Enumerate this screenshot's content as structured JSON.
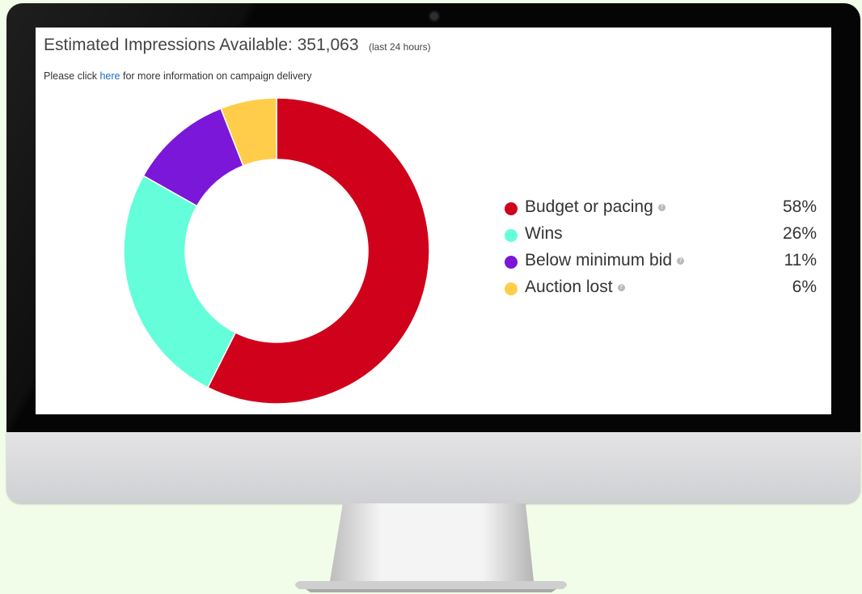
{
  "header": {
    "title": "Estimated Impressions Available: 351,063",
    "note": "(last 24 hours)"
  },
  "info": {
    "prefix": "Please click",
    "link": "here",
    "suffix": "for more information on campaign delivery"
  },
  "icons": {
    "help": "?"
  },
  "chart_data": {
    "type": "pie",
    "donut": true,
    "categories": [
      "Budget or pacing",
      "Wins",
      "Below minimum bid",
      "Auction lost"
    ],
    "values": [
      58,
      26,
      11,
      6
    ],
    "value_labels": [
      "58%",
      "26%",
      "11%",
      "6%"
    ],
    "colors": [
      "#d0021b",
      "#64ffda",
      "#7b17d8",
      "#ffcd4a"
    ],
    "legend_position": "right"
  }
}
